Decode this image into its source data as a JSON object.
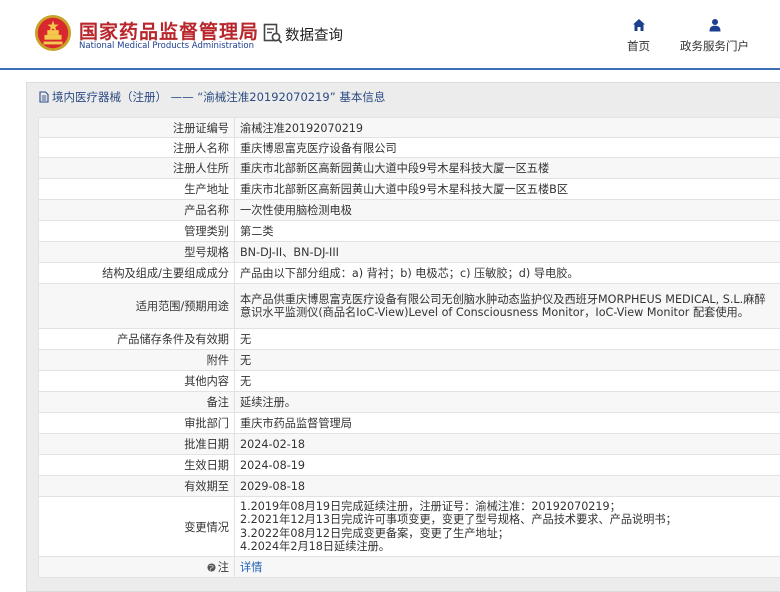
{
  "header": {
    "brand_cn": "国家药品监督管理局",
    "brand_en": "National Medical Products Administration",
    "search_label": "数据查询",
    "nav_home": "首页",
    "nav_portal": "政务服务门户",
    "colors": {
      "brand_red": "#b8262b",
      "brand_blue": "#1d3f8f",
      "accent": "#3e6fb5"
    }
  },
  "breadcrumb": {
    "text": "境内医疗器械（注册） —— “渝械注准20192070219” 基本信息"
  },
  "table": {
    "rows": [
      {
        "label": "注册证编号",
        "value": "渝械注准20192070219"
      },
      {
        "label": "注册人名称",
        "value": "重庆博恩富克医疗设备有限公司"
      },
      {
        "label": "注册人住所",
        "value": "重庆市北部新区高新园黄山大道中段9号木星科技大厦一区五楼"
      },
      {
        "label": "生产地址",
        "value": "重庆市北部新区高新园黄山大道中段9号木星科技大厦一区五楼B区"
      },
      {
        "label": "产品名称",
        "value": "一次性使用脑检测电极"
      },
      {
        "label": "管理类别",
        "value": "第二类"
      },
      {
        "label": "型号规格",
        "value": "BN-DJ-II、BN-DJ-III"
      },
      {
        "label": "结构及组成/主要组成成分",
        "value": "产品由以下部分组成：a) 背衬；b) 电极芯；c) 压敏胶；d) 导电胶。"
      },
      {
        "label": "适用范围/预期用途",
        "value": "本产品供重庆博恩富克医疗设备有限公司无创脑水肿动态监护仪及西班牙MORPHEUS MEDICAL, S.L.麻醉意识水平监测仪(商品名IoC-View)Level of Consciousness Monitor，IoC-View Monitor 配套使用。"
      },
      {
        "label": "产品储存条件及有效期",
        "value": "无"
      },
      {
        "label": "附件",
        "value": "无"
      },
      {
        "label": "其他内容",
        "value": "无"
      },
      {
        "label": "备注",
        "value": "延续注册。"
      },
      {
        "label": "审批部门",
        "value": "重庆市药品监督管理局"
      },
      {
        "label": "批准日期",
        "value": "2024-02-18"
      },
      {
        "label": "生效日期",
        "value": "2024-08-19"
      },
      {
        "label": "有效期至",
        "value": "2029-08-18"
      }
    ],
    "change_label": "变更情况",
    "change_lines": [
      "1.2019年08月19日完成延续注册，注册证号：渝械注准：20192070219；",
      "2.2021年12月13日完成许可事项变更，变更了型号规格、产品技术要求、产品说明书；",
      "3.2022年08月12日完成变更备案，变更了生产地址；",
      "4.2024年2月18日延续注册。"
    ],
    "note_label": "注",
    "note_link": "详情"
  }
}
